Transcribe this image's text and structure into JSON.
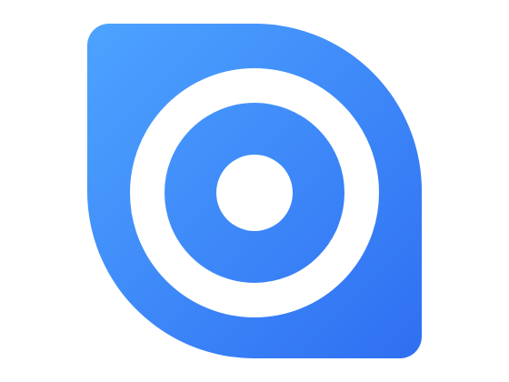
{
  "logo": {
    "name": "app-logo-eye-target",
    "colors": {
      "gradient_start": "#4DA3FF",
      "gradient_end": "#2F6FF2",
      "ring": "#FFFFFF",
      "background": "#FFFFFF"
    }
  }
}
